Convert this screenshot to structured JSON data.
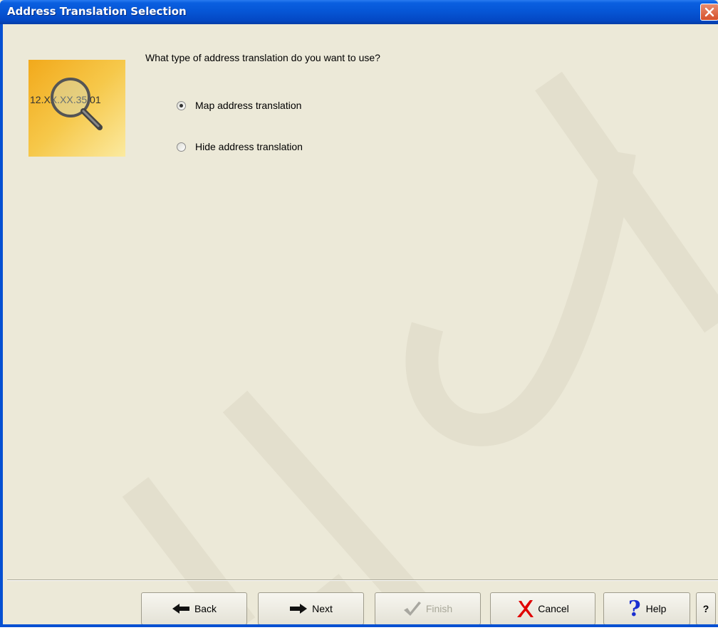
{
  "window": {
    "title": "Address Translation Selection"
  },
  "wizard_image": {
    "text": "12.XX.XX.35.01",
    "icon": "magnifier-icon"
  },
  "question": "What type of address translation do you want to use?",
  "options": [
    {
      "label": "Map address translation",
      "selected": true
    },
    {
      "label": "Hide address translation",
      "selected": false
    }
  ],
  "buttons": {
    "back": "Back",
    "next": "Next",
    "finish": "Finish",
    "cancel": "Cancel",
    "help": "Help",
    "context_help": "?"
  },
  "watermark": "Archived",
  "colors": {
    "titlebar": "#0656d6",
    "dialog_bg": "#ece9d8",
    "close_button": "#d5502a",
    "cancel_icon": "#e00000",
    "help_icon": "#1a2fd0"
  }
}
